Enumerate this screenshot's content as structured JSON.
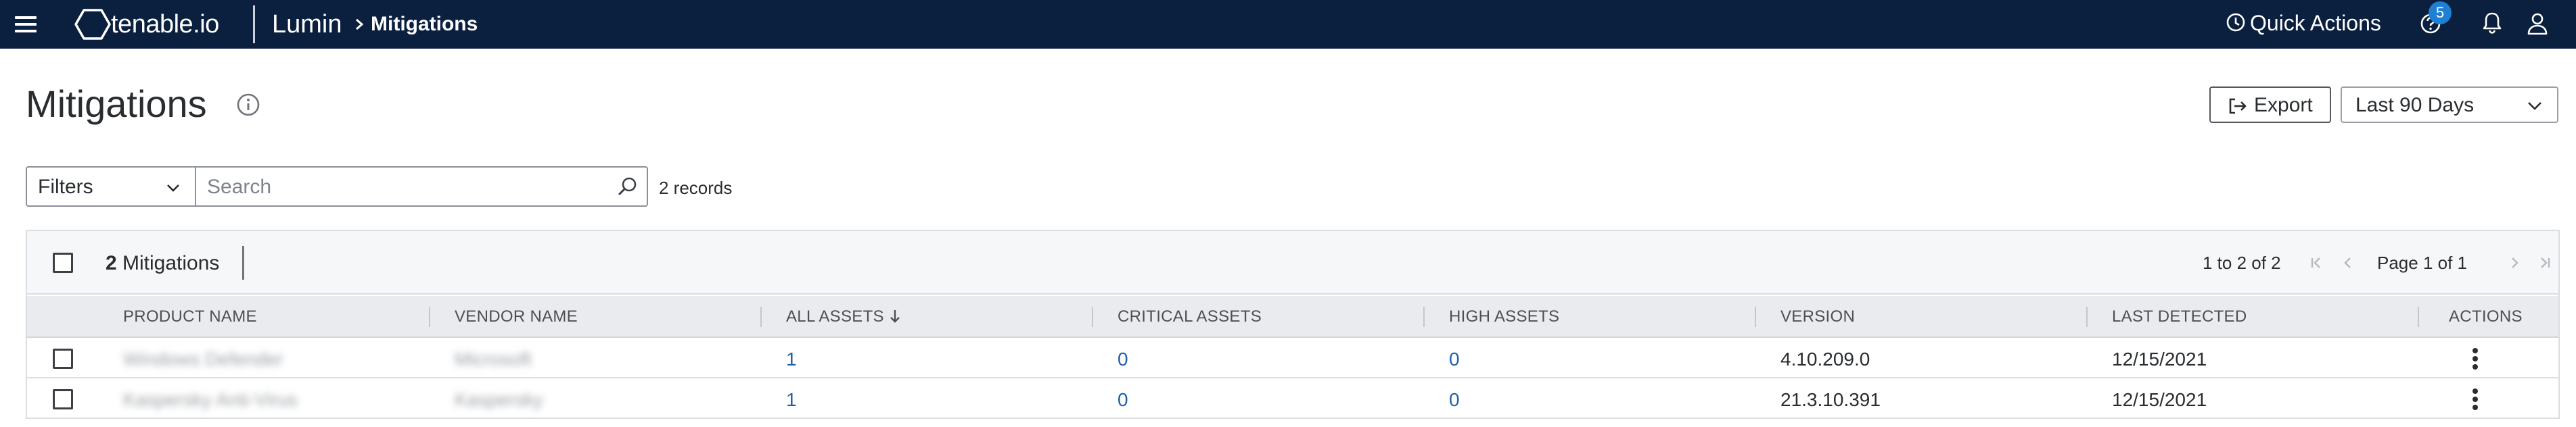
{
  "topbar": {
    "brand": "tenable.io",
    "product": "Lumin",
    "breadcrumb": "Mitigations",
    "quick_actions": "Quick Actions",
    "help_badge": "5"
  },
  "page": {
    "title": "Mitigations",
    "export_label": "Export",
    "range_selected": "Last 90 Days"
  },
  "filter_bar": {
    "filters_label": "Filters",
    "search_placeholder": "Search",
    "search_value": "",
    "records_text": "2 records"
  },
  "table": {
    "selection_count": "2",
    "selection_label": "Mitigations",
    "range_text": "1 to 2 of 2",
    "page_text": "Page 1 of 1",
    "columns": [
      "PRODUCT NAME",
      "VENDOR NAME",
      "ALL ASSETS",
      "CRITICAL ASSETS",
      "HIGH ASSETS",
      "VERSION",
      "LAST DETECTED",
      "ACTIONS"
    ],
    "rows": [
      {
        "product": "Windows Defender",
        "vendor": "Microsoft",
        "all_assets": "1",
        "critical_assets": "0",
        "high_assets": "0",
        "version": "4.10.209.0",
        "last_detected": "12/15/2021"
      },
      {
        "product": "Kaspersky Anti-Virus",
        "vendor": "Kaspersky",
        "all_assets": "1",
        "critical_assets": "0",
        "high_assets": "0",
        "version": "21.3.10.391",
        "last_detected": "12/15/2021"
      }
    ]
  },
  "colors": {
    "topbar": "#0b1f3f",
    "link": "#1f5fa8",
    "badge": "#1f7fd3"
  },
  "icons": [
    "menu-icon",
    "hexagon-logo-icon",
    "chevron-right-icon",
    "clock-icon",
    "help-icon",
    "bell-icon",
    "user-icon",
    "info-icon",
    "export-icon",
    "chevron-down-icon",
    "search-icon",
    "first-page-icon",
    "previous-page-icon",
    "next-page-icon",
    "last-page-icon",
    "sort-down-icon",
    "kebab-icon"
  ]
}
